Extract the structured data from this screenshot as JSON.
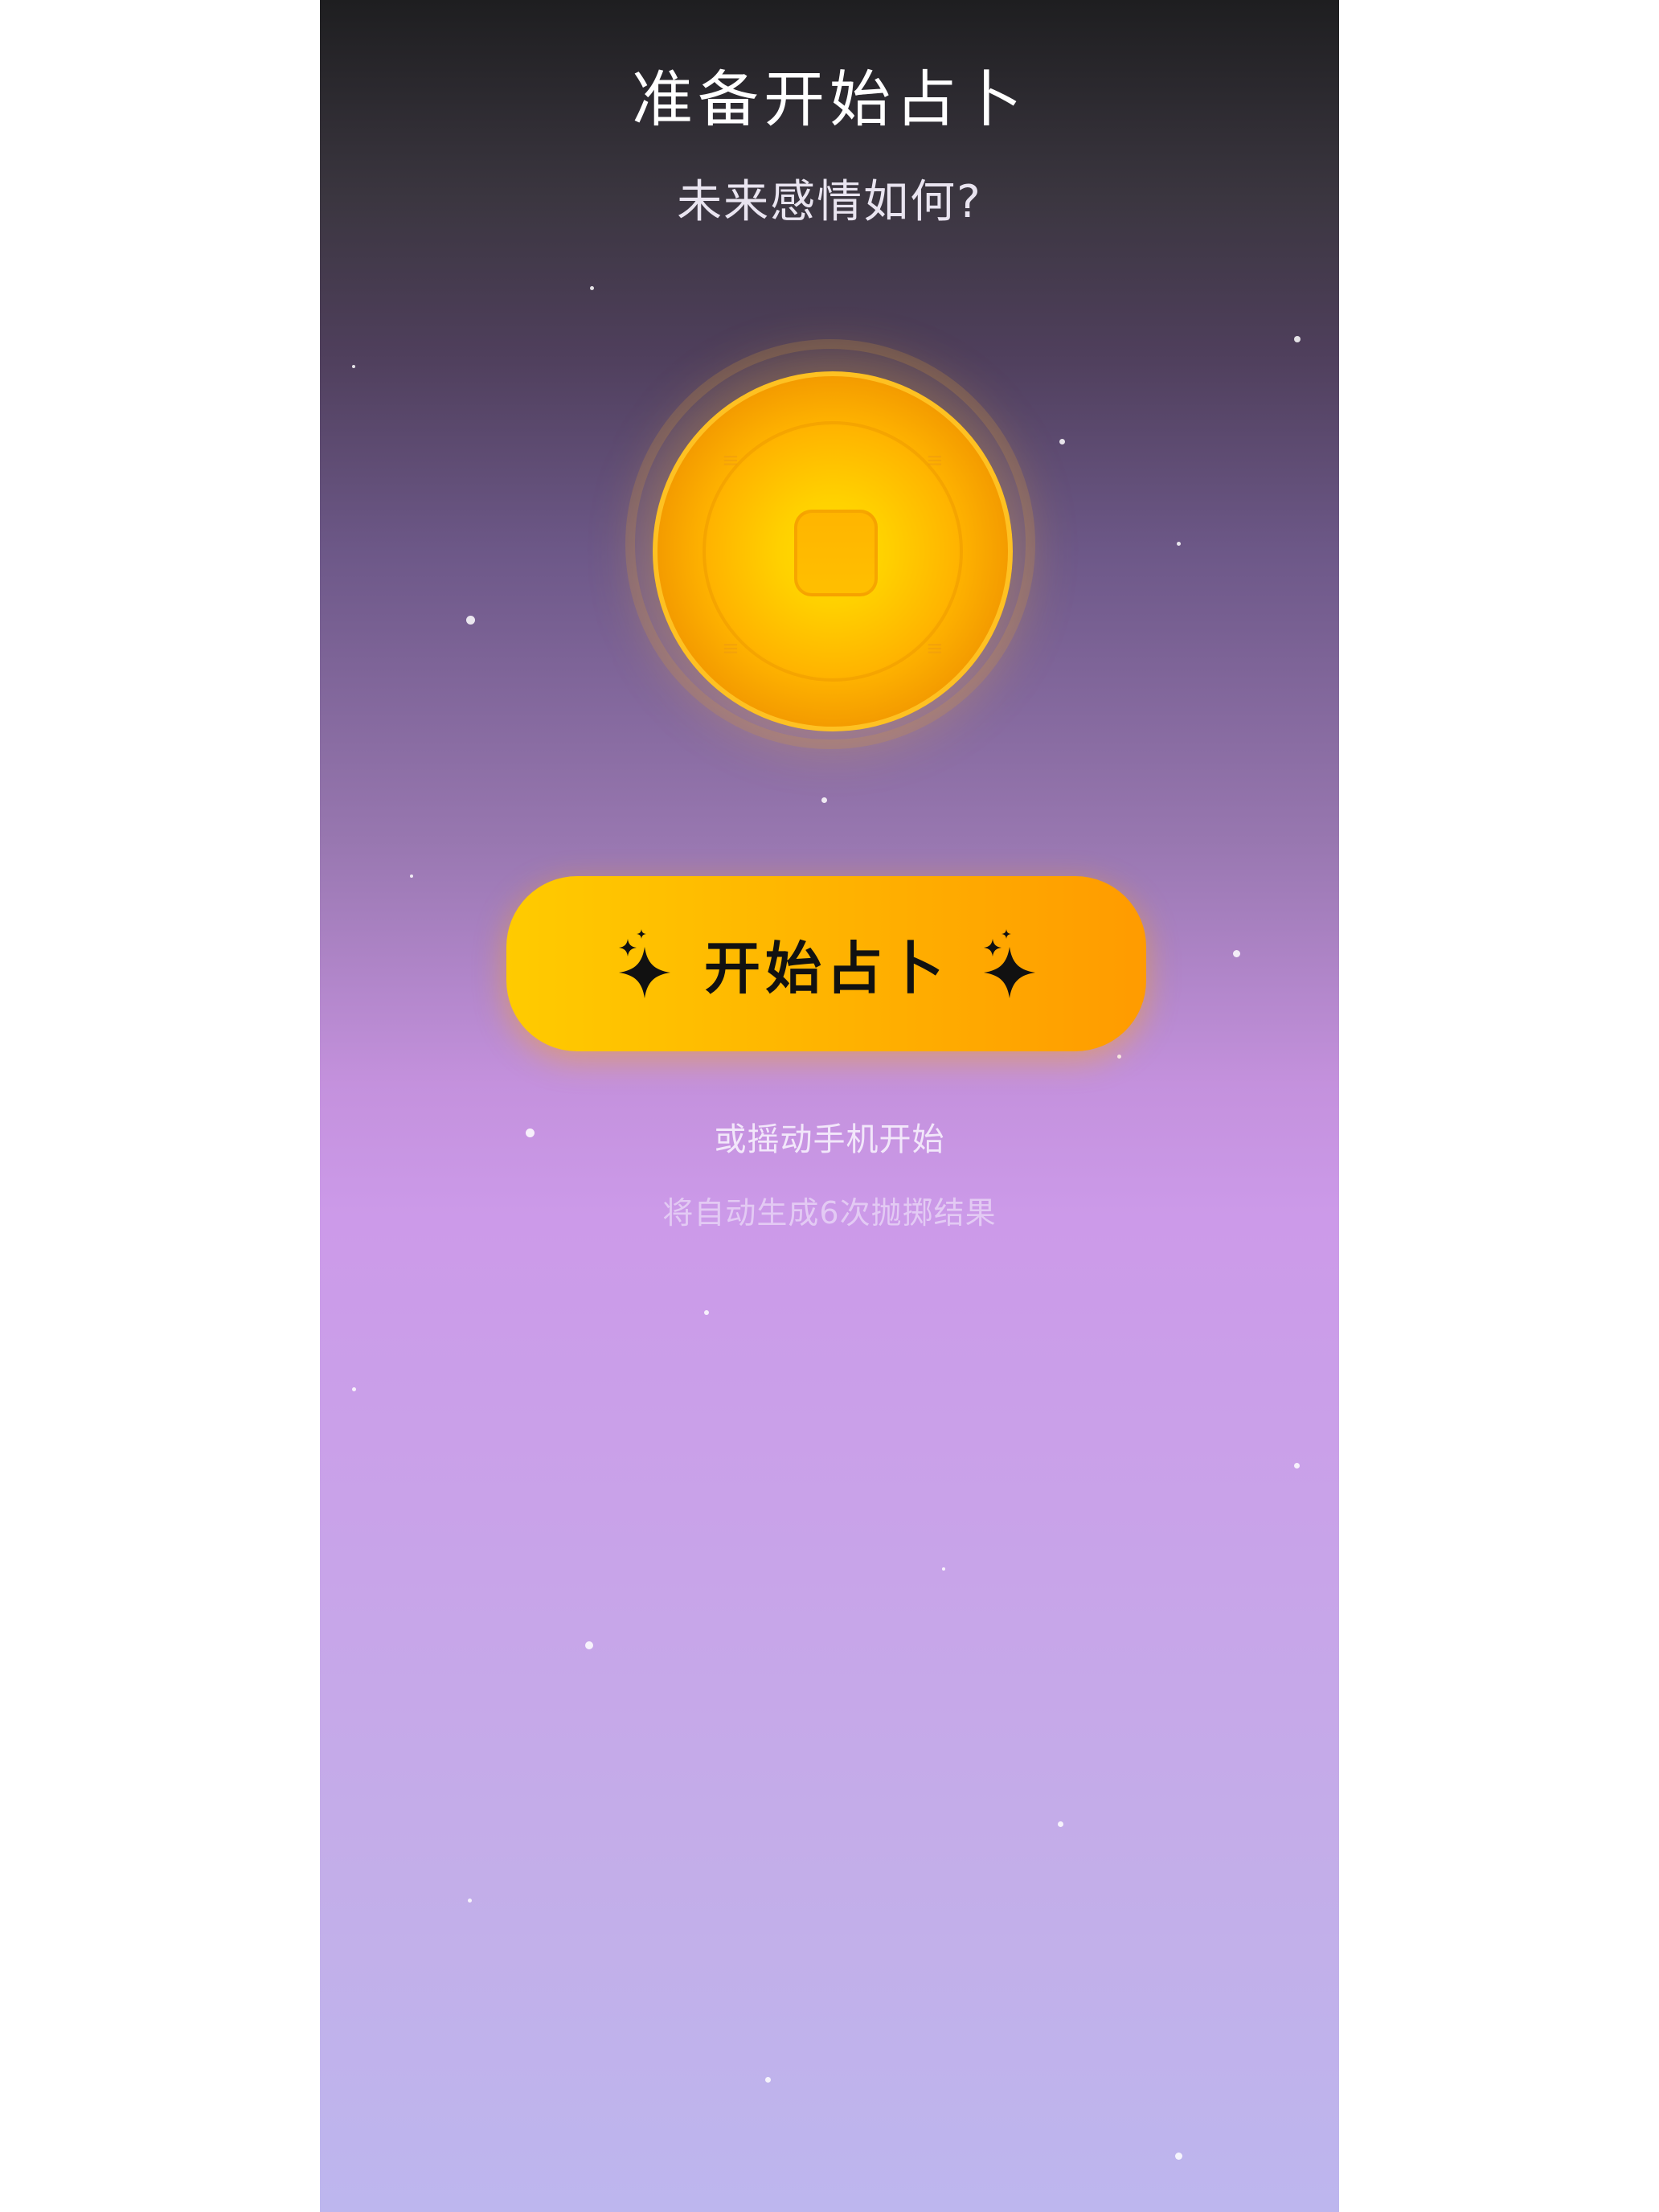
{
  "header": {
    "title": "准备开始占卜",
    "subtitle": "未来感情如何?"
  },
  "coin": {
    "icon": "coin-icon"
  },
  "start_button": {
    "label": "开始占卜",
    "icon": "sparkles-icon"
  },
  "hints": {
    "shake": "或摇动手机开始",
    "auto_generate": "将自动生成6次抛掷结果"
  },
  "colors": {
    "button_start": "#ffcb00",
    "button_end": "#ff9b00",
    "coin_center": "#ffe000",
    "bg_top": "#1e1e20",
    "bg_bottom": "#bdb6ee"
  }
}
